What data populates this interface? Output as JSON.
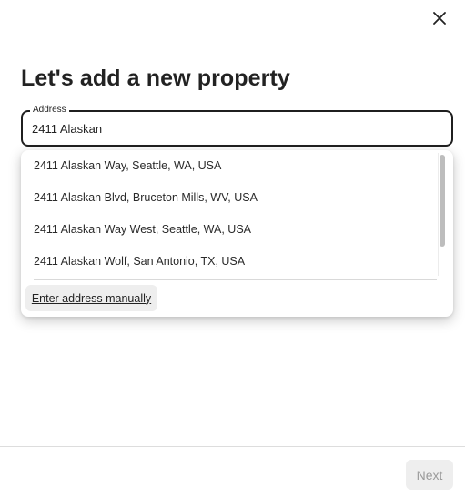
{
  "header": {
    "close_icon": "close-icon",
    "title": "Let's add a new property"
  },
  "address": {
    "legend": "Address",
    "value": "2411 Alaskan",
    "suggestions": [
      "2411 Alaskan Way, Seattle, WA, USA",
      "2411 Alaskan Blvd, Bruceton Mills, WV, USA",
      "2411 Alaskan Way West, Seattle, WA, USA",
      "2411 Alaskan Wolf, San Antonio, TX, USA"
    ],
    "manual_label": "Enter address manually"
  },
  "footer": {
    "next_label": "Next",
    "next_enabled": false
  },
  "colors": {
    "text": "#222222",
    "border": "#1f1f1f",
    "disabled_bg": "#eeeeee",
    "disabled_text": "#9a9a9a"
  }
}
